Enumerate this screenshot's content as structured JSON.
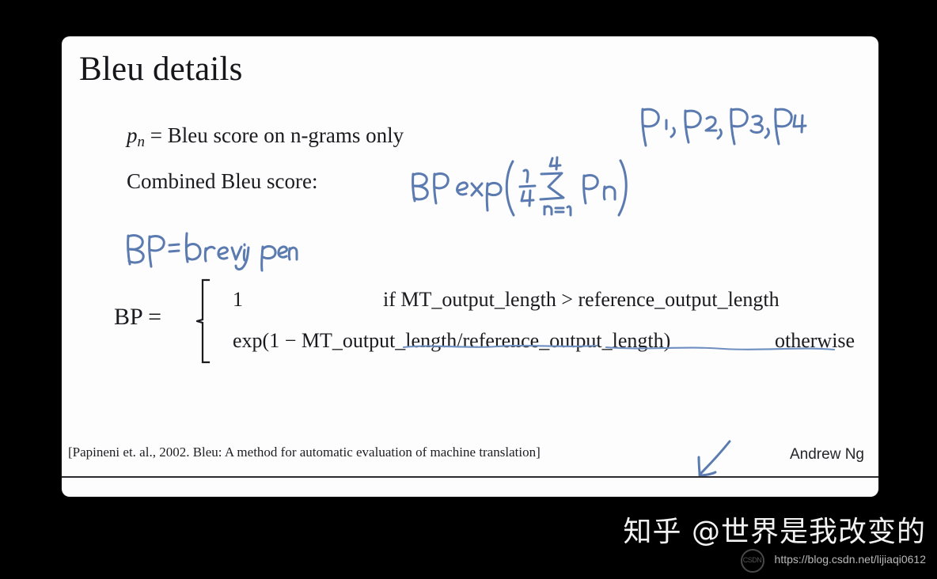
{
  "slide": {
    "title": "Bleu details",
    "body": {
      "pn_symbol": "p",
      "pn_subscript": "n",
      "pn_definition": "= Bleu score on n-grams only",
      "combined_label": "Combined Bleu score:"
    },
    "bp_equation": {
      "lhs": "BP =",
      "case1_value": "1",
      "case1_condition_prefix": "if ",
      "case1_condition_left": "MT_output_length",
      "case1_condition_operator": " > ",
      "case1_condition_right": "reference_output_length",
      "case2_value": "exp(1 − MT_output_length/reference_output_length)",
      "case2_condition": "otherwise"
    },
    "annotations": {
      "p_list": "P1, P2, P3, P4",
      "combined_formula": "BP exp( 1/4 Σ n=1..4 Pn )",
      "bp_definition": "BP = brevity penalty",
      "arrow": "down-left arrow pointing at citation",
      "underline_1": "MT_output_length",
      "underline_2": "reference_output_length"
    },
    "footer": {
      "citation": "[Papineni et. al., 2002. Bleu: A method for automatic evaluation of machine translation]",
      "presenter": "Andrew Ng"
    }
  },
  "watermark": {
    "handle": "知乎 @世界是我改变的",
    "url": "https://blog.csdn.net/lijiaqi0612",
    "badge": "CSDN"
  },
  "colors": {
    "background": "#000000",
    "slide": "#fdfdfd",
    "text": "#1a1a1f",
    "ink": "#5b7bb0"
  }
}
